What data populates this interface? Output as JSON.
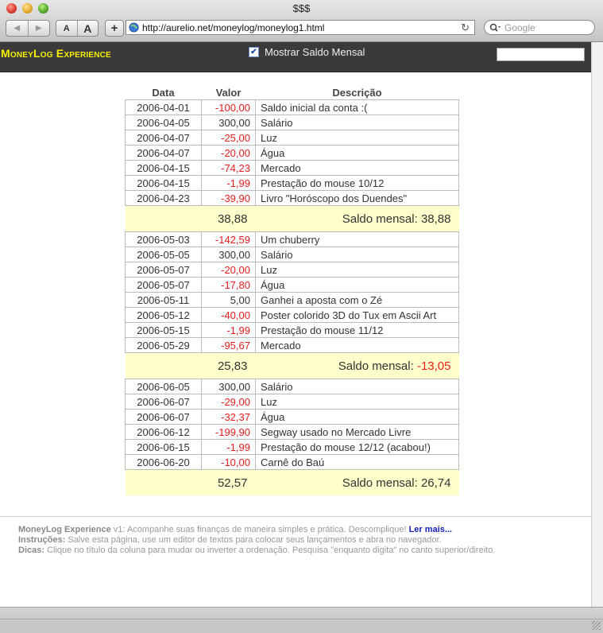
{
  "window": {
    "title": "$$$"
  },
  "toolbar": {
    "back_label": "◀",
    "forward_label": "▶",
    "font_small": "A",
    "font_large": "A",
    "add_label": "+",
    "url": "http://aurelio.net/moneylog/moneylog1.html",
    "reload_label": "↻",
    "search_placeholder": "Google"
  },
  "app": {
    "title": "MoneyLog Experience",
    "checkbox_label": "Mostrar Saldo Mensal",
    "checkbox_checked": true,
    "search_value": ""
  },
  "table": {
    "headers": {
      "date": "Data",
      "value": "Valor",
      "description": "Descrição"
    },
    "months": [
      {
        "rows": [
          {
            "date": "2006-04-01",
            "value": "-100,00",
            "desc": "Saldo inicial da conta :("
          },
          {
            "date": "2006-04-05",
            "value": "300,00",
            "desc": "Salário"
          },
          {
            "date": "2006-04-07",
            "value": "-25,00",
            "desc": "Luz"
          },
          {
            "date": "2006-04-07",
            "value": "-20,00",
            "desc": "Água"
          },
          {
            "date": "2006-04-15",
            "value": "-74,23",
            "desc": "Mercado"
          },
          {
            "date": "2006-04-15",
            "value": "-1,99",
            "desc": "Prestação do mouse 10/12"
          },
          {
            "date": "2006-04-23",
            "value": "-39,90",
            "desc": "Livro \"Horóscopo dos Duendes\""
          }
        ],
        "total": "38,88",
        "balance_label": "Saldo mensal:",
        "balance": "38,88"
      },
      {
        "rows": [
          {
            "date": "2006-05-03",
            "value": "-142,59",
            "desc": "Um chuberry"
          },
          {
            "date": "2006-05-05",
            "value": "300,00",
            "desc": "Salário"
          },
          {
            "date": "2006-05-07",
            "value": "-20,00",
            "desc": "Luz"
          },
          {
            "date": "2006-05-07",
            "value": "-17,80",
            "desc": "Água"
          },
          {
            "date": "2006-05-11",
            "value": "5,00",
            "desc": "Ganhei a aposta com o Zé"
          },
          {
            "date": "2006-05-12",
            "value": "-40,00",
            "desc": "Poster colorido 3D do Tux em Ascii Art"
          },
          {
            "date": "2006-05-15",
            "value": "-1,99",
            "desc": "Prestação do mouse 11/12"
          },
          {
            "date": "2006-05-29",
            "value": "-95,67",
            "desc": "Mercado"
          }
        ],
        "total": "25,83",
        "balance_label": "Saldo mensal:",
        "balance": "-13,05"
      },
      {
        "rows": [
          {
            "date": "2006-06-05",
            "value": "300,00",
            "desc": "Salário"
          },
          {
            "date": "2006-06-07",
            "value": "-29,00",
            "desc": "Luz"
          },
          {
            "date": "2006-06-07",
            "value": "-32,37",
            "desc": "Água"
          },
          {
            "date": "2006-06-12",
            "value": "-199,90",
            "desc": "Segway usado no Mercado Livre"
          },
          {
            "date": "2006-06-15",
            "value": "-1,99",
            "desc": "Prestação do mouse 12/12 (acabou!)"
          },
          {
            "date": "2006-06-20",
            "value": "-10,00",
            "desc": "Carnê do Baú"
          }
        ],
        "total": "52,57",
        "balance_label": "Saldo mensal:",
        "balance": "26,74"
      }
    ]
  },
  "footer": {
    "line1_bold": "MoneyLog Experience",
    "line1_text": " v1: Acompanhe suas finanças de maneira simples e prática. Descomplique! ",
    "line1_link": "Ler mais...",
    "line2_bold": "Instruções:",
    "line2_text": " Salve esta página, use um editor de textos para colocar seus lançamentos e abra no navegador.",
    "line3_bold": "Dicas:",
    "line3_text": " Clique no título da coluna para mudar ou inverter a ordenação. Pesquisa \"enquanto digita\" no canto superior/direito."
  },
  "colors": {
    "negative": "#e81c1c",
    "summary_bg": "#ffffcc",
    "header_bg": "#3a3a3a",
    "title_yellow": "#f4f000",
    "link_blue": "#1420b8"
  },
  "icons": [
    "close-icon",
    "minimize-icon",
    "zoom-icon",
    "back-arrow-icon",
    "forward-arrow-icon",
    "globe-icon",
    "reload-icon",
    "search-icon",
    "checkmark-icon",
    "resize-grip-icon"
  ]
}
